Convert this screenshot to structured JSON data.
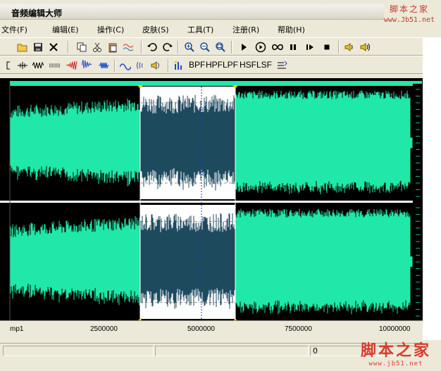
{
  "window": {
    "title": "音频编辑大师"
  },
  "watermark": {
    "top_line1": "脚本之家",
    "top_line2": "www.Jb51.net",
    "bottom_line1": "脚本之家",
    "bottom_line2": "www.jb51.net",
    "color": "#d93a2a"
  },
  "menu": [
    {
      "label": "文件(F)"
    },
    {
      "label": "编辑(E)"
    },
    {
      "label": "操作(C)"
    },
    {
      "label": "皮肤(S)"
    },
    {
      "label": "工具(T)"
    },
    {
      "label": "注册(R)"
    },
    {
      "label": "帮助(H)"
    }
  ],
  "toolbar1": {
    "icons": [
      "open-folder-icon",
      "save-icon",
      "cut-x-icon",
      "copy-icon",
      "cut-scissors-icon",
      "paste-icon",
      "mix-paste-icon",
      "undo-icon",
      "redo-icon",
      "zoom-in-icon",
      "zoom-out-icon",
      "zoom-fit-icon",
      "play-icon",
      "play-circle-icon",
      "loop-icon",
      "pause-icon",
      "play-pause-icon",
      "stop-icon",
      "volume-left-icon",
      "volume-right-icon"
    ]
  },
  "toolbar2": {
    "filters": [
      "BPF",
      "HPF",
      "LPF",
      "HSF",
      "LSF"
    ]
  },
  "waveform": {
    "wave_color": "#20e8a8",
    "selected_wave_color": "#1e4a5e",
    "selection_bg": "#ffffff",
    "background": "#000000"
  },
  "ruler": {
    "labels": [
      "mp1",
      "2500000",
      "5000000",
      "7500000",
      "10000000"
    ]
  },
  "status": {
    "value": "0"
  }
}
